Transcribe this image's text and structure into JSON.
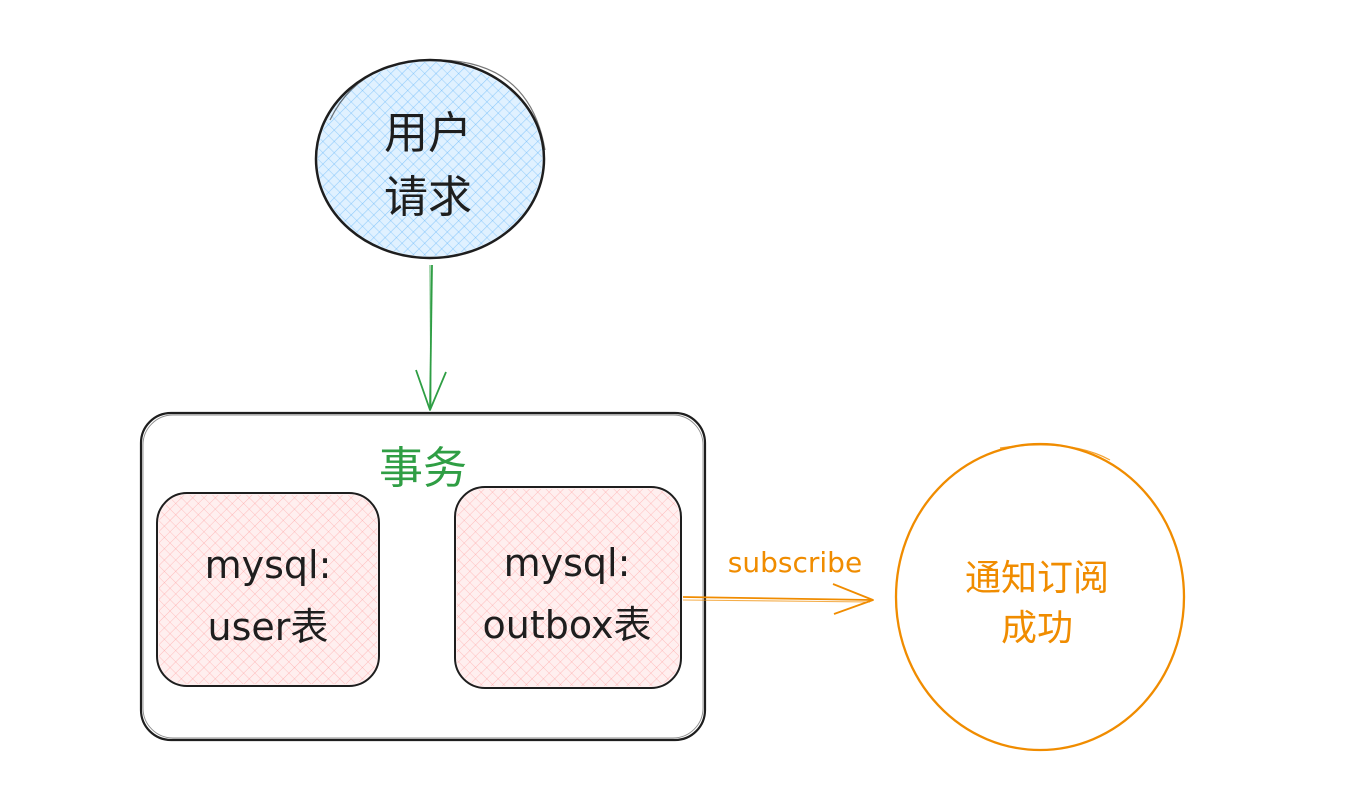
{
  "nodes": {
    "user_request": {
      "line1": "用户",
      "line2": "请求",
      "fill": "#a5d8ff",
      "stroke": "#1e1e1e"
    },
    "transaction": {
      "title": "事务",
      "title_color": "#2f9e44",
      "stroke": "#1e1e1e"
    },
    "user_table": {
      "line1": "mysql:",
      "line2": "user表",
      "fill": "#ffc9c9",
      "stroke": "#1e1e1e"
    },
    "outbox_table": {
      "line1": "mysql:",
      "line2": "outbox表",
      "fill": "#ffc9c9",
      "stroke": "#1e1e1e"
    },
    "notify_success": {
      "line1": "通知订阅",
      "line2": "成功",
      "stroke": "#f08c00",
      "text_color": "#f08c00"
    }
  },
  "edges": {
    "request_to_transaction": {
      "color": "#2f9e44"
    },
    "outbox_to_notify": {
      "label": "subscribe",
      "color": "#f08c00"
    }
  }
}
